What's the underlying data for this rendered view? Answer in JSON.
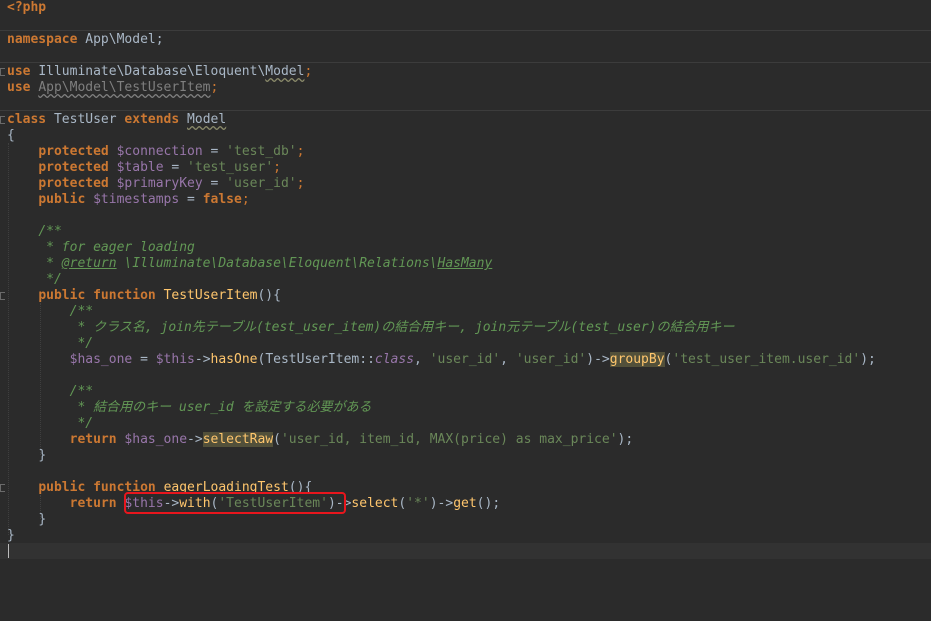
{
  "code": {
    "open_tag": "<?php",
    "namespace_kw": "namespace",
    "namespace_name": "App\\Model;",
    "use_kw": "use",
    "use1_prefix": "Illuminate\\Database\\Eloquent\\",
    "use1_class": "Model",
    "use2_path": "App\\Model\\TestUserItem",
    "class_kw": "class",
    "class_name": "TestUser",
    "extends_kw": "extends",
    "parent_class": "Model",
    "brace_open": "{",
    "brace_close": "}",
    "protected_kw": "protected",
    "public_kw": "public",
    "prop_connection": "$connection",
    "val_connection": "'test_db'",
    "prop_table": "$table",
    "val_table": "'test_user'",
    "prop_primarykey": "$primaryKey",
    "val_primarykey": "'user_id'",
    "prop_timestamps": "$timestamps",
    "false_kw": "false",
    "doc1_open": "/**",
    "doc1_desc": " * for eager loading",
    "doc1_star": " * ",
    "doc1_tag": "@return",
    "doc1_type_prefix": " \\Illuminate\\Database\\Eloquent\\Relations\\",
    "doc1_type_class": "HasMany",
    "doc_close": " */",
    "function_kw": "function",
    "fn1_name": "TestUserItem",
    "doc2_open": "/**",
    "doc2_text": " * クラス名, join先テーブル(test_user_item)の結合用キー, join元テーブル(test_user)の結合用キー",
    "var_has_one": "$has_one",
    "this_kw": "$this",
    "m_hasone": "hasOne",
    "cls_testuseritem": "TestUserItem",
    "class_const": "class",
    "str_user_id": "'user_id'",
    "m_groupby": "groupBy",
    "str_groupby_arg": "'test_user_item.user_id'",
    "doc3_open": "/**",
    "doc3_text": " * 結合用のキー user_id を設定する必要がある",
    "return_kw": "return",
    "m_selectraw": "selectRaw",
    "str_selectraw_arg": "'user_id, item_id, MAX(price) as max_price'",
    "fn2_name": "eagerLoadingTest",
    "m_with": "with",
    "str_with_arg": "'TestUserItem'",
    "m_select": "select",
    "str_star": "'*'",
    "m_get": "get"
  }
}
